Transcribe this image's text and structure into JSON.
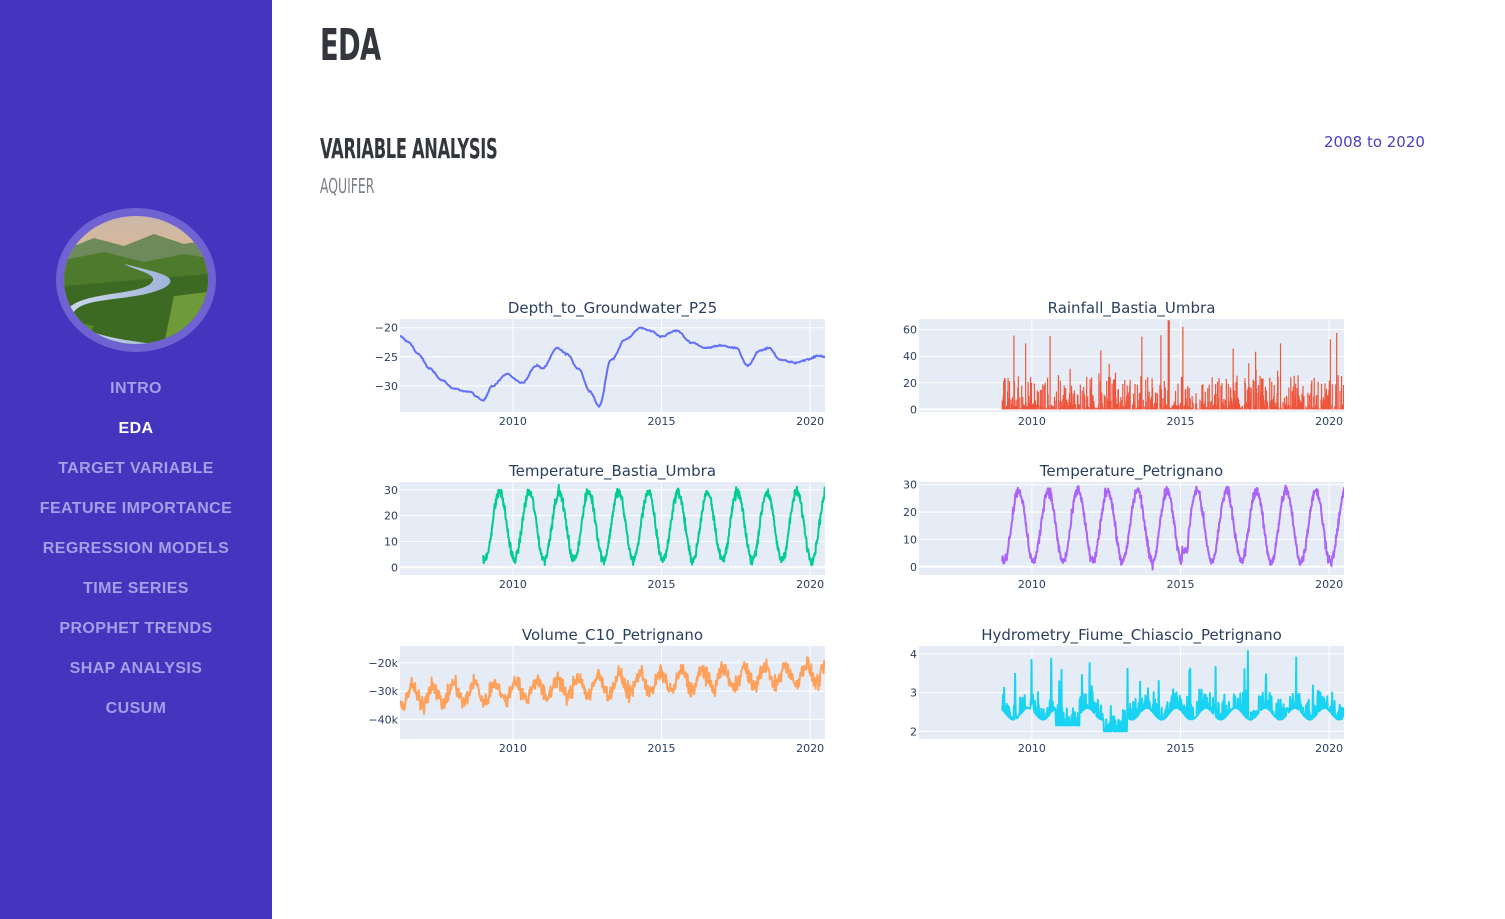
{
  "nav": {
    "items": [
      {
        "label": "INTRO",
        "active": false
      },
      {
        "label": "EDA",
        "active": true
      },
      {
        "label": "TARGET VARIABLE",
        "active": false
      },
      {
        "label": "FEATURE IMPORTANCE",
        "active": false
      },
      {
        "label": "REGRESSION MODELS",
        "active": false
      },
      {
        "label": "TIME SERIES",
        "active": false
      },
      {
        "label": "PROPHET TRENDS",
        "active": false
      },
      {
        "label": "SHAP ANALYSIS",
        "active": false
      },
      {
        "label": "CUSUM",
        "active": false
      }
    ]
  },
  "page": {
    "title": "EDA",
    "section_title": "VARIABLE ANALYSIS",
    "section_subtitle": "AQUIFER",
    "date_range": "2008 to 2020"
  },
  "colors": {
    "sidebar": "#4335bd",
    "nav_inactive": "#a69ee8",
    "nav_active": "#ffffff",
    "plot_bg": "#e5ecf6"
  },
  "chart_data": [
    {
      "type": "line",
      "title": "Depth_to_Groundwater_P25",
      "color": "#636efa",
      "xlim": [
        2006.2,
        2020.5
      ],
      "ylim": [
        -34.5,
        -18.5
      ],
      "yticks": [
        -20,
        -25,
        -30
      ],
      "ytick_labels": [
        "−20",
        "−25",
        "−30"
      ],
      "xticks": [
        2010,
        2015,
        2020
      ],
      "x": [
        2006.2,
        2006.5,
        2006.8,
        2007.2,
        2007.6,
        2008.0,
        2008.5,
        2009.0,
        2009.3,
        2009.8,
        2010.3,
        2010.8,
        2011.0,
        2011.5,
        2011.8,
        2012.2,
        2012.6,
        2012.9,
        2013.3,
        2013.8,
        2014.3,
        2014.6,
        2015.0,
        2015.5,
        2016.0,
        2016.5,
        2017.0,
        2017.5,
        2017.9,
        2018.3,
        2018.6,
        2019.0,
        2019.5,
        2019.9,
        2020.3,
        2020.5
      ],
      "y": [
        -21.5,
        -22.5,
        -24.5,
        -27.0,
        -29.0,
        -30.5,
        -31.0,
        -32.5,
        -30.0,
        -28.0,
        -29.5,
        -26.5,
        -27.0,
        -23.5,
        -24.5,
        -27.0,
        -31.0,
        -33.5,
        -25.5,
        -22.0,
        -20.0,
        -20.5,
        -21.5,
        -20.5,
        -22.5,
        -23.5,
        -23.0,
        -23.5,
        -26.5,
        -24.0,
        -23.5,
        -25.5,
        -26.0,
        -25.5,
        -24.8,
        -25.0
      ],
      "noise": 0.25
    },
    {
      "type": "bar",
      "title": "Rainfall_Bastia_Umbra",
      "color": "#ef553b",
      "xlim": [
        2006.2,
        2020.5
      ],
      "ylim": [
        -2,
        68
      ],
      "yticks": [
        60,
        40,
        20,
        0
      ],
      "ytick_labels": [
        "60",
        "40",
        "20",
        "0"
      ],
      "xticks": [
        2010,
        2015,
        2020
      ],
      "data_start": 2009.0,
      "data_end": 2020.5,
      "max_value": 67
    },
    {
      "type": "line",
      "title": "Temperature_Bastia_Umbra",
      "color": "#00cc96",
      "xlim": [
        2006.2,
        2020.5
      ],
      "ylim": [
        -3,
        33
      ],
      "yticks": [
        30,
        20,
        10,
        0
      ],
      "ytick_labels": [
        "30",
        "20",
        "10",
        "0"
      ],
      "xticks": [
        2010,
        2015,
        2020
      ],
      "data_start": 2009.0,
      "data_end": 2020.5,
      "range": [
        0,
        32
      ]
    },
    {
      "type": "line",
      "title": "Temperature_Petrignano",
      "color": "#ab63fa",
      "xlim": [
        2006.2,
        2020.5
      ],
      "ylim": [
        -3,
        31
      ],
      "yticks": [
        30,
        20,
        10,
        0
      ],
      "ytick_labels": [
        "30",
        "20",
        "10",
        "0"
      ],
      "xticks": [
        2010,
        2015,
        2020
      ],
      "data_start": 2009.0,
      "data_end": 2020.5,
      "range": [
        -1,
        31
      ]
    },
    {
      "type": "line",
      "title": "Volume_C10_Petrignano",
      "color": "#ffa15a",
      "xlim": [
        2006.2,
        2020.5
      ],
      "ylim": [
        -47000,
        -14000
      ],
      "yticks": [
        -20000,
        -30000,
        -40000
      ],
      "ytick_labels": [
        "−20k",
        "−30k",
        "−40k"
      ],
      "xticks": [
        2010,
        2015,
        2020
      ],
      "data_start": 2006.2,
      "data_end": 2020.5,
      "range": [
        -45000,
        -17000
      ]
    },
    {
      "type": "line",
      "title": "Hydrometry_Fiume_Chiascio_Petrignano",
      "color": "#19d3f3",
      "xlim": [
        2006.2,
        2020.5
      ],
      "ylim": [
        1.8,
        4.2
      ],
      "yticks": [
        4,
        3,
        2
      ],
      "ytick_labels": [
        "4",
        "3",
        "2"
      ],
      "xticks": [
        2010,
        2015,
        2020
      ],
      "data_start": 2009.0,
      "data_end": 2020.5,
      "range": [
        1.85,
        4.1
      ]
    }
  ]
}
